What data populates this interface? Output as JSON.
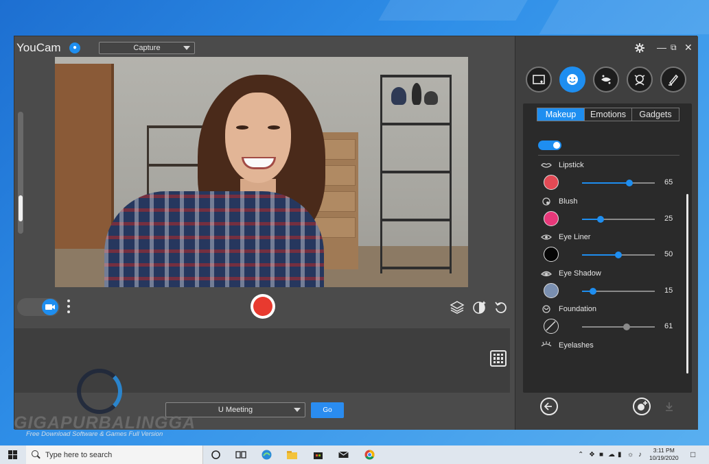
{
  "app": {
    "title": "YouCam",
    "mode_select": "Capture",
    "meeting_select": "U Meeting",
    "go_label": "Go"
  },
  "tabs": [
    {
      "label": "Makeup",
      "active": true
    },
    {
      "label": "Emotions",
      "active": false
    },
    {
      "label": "Gadgets",
      "active": false
    }
  ],
  "makeup": [
    {
      "label": "Lipstick",
      "value": "65",
      "level": 0.65,
      "color": "#e24a55",
      "icon": "lips-icon"
    },
    {
      "label": "Blush",
      "value": "25",
      "level": 0.25,
      "color": "#e8387a",
      "icon": "blush-icon"
    },
    {
      "label": "Eye Liner",
      "value": "50",
      "level": 0.5,
      "color": "#050505",
      "icon": "eye-liner-icon"
    },
    {
      "label": "Eye Shadow",
      "value": "15",
      "level": 0.15,
      "color": "#7a8fb0",
      "icon": "eye-shadow-icon"
    },
    {
      "label": "Foundation",
      "value": "61",
      "level": 0.61,
      "color": "none",
      "icon": "foundation-icon"
    },
    {
      "label": "Eyelashes",
      "icon": "eyelashes-icon"
    }
  ],
  "watermark": {
    "title": "GIGAPURBALINGGA",
    "subtitle": "Free Download Software & Games Full Version"
  },
  "taskbar": {
    "search_placeholder": "Type here to search",
    "time": "3:11 PM",
    "date": "10/19/2020"
  },
  "colors": {
    "accent": "#1e8ef0",
    "record": "#e83a2f"
  }
}
